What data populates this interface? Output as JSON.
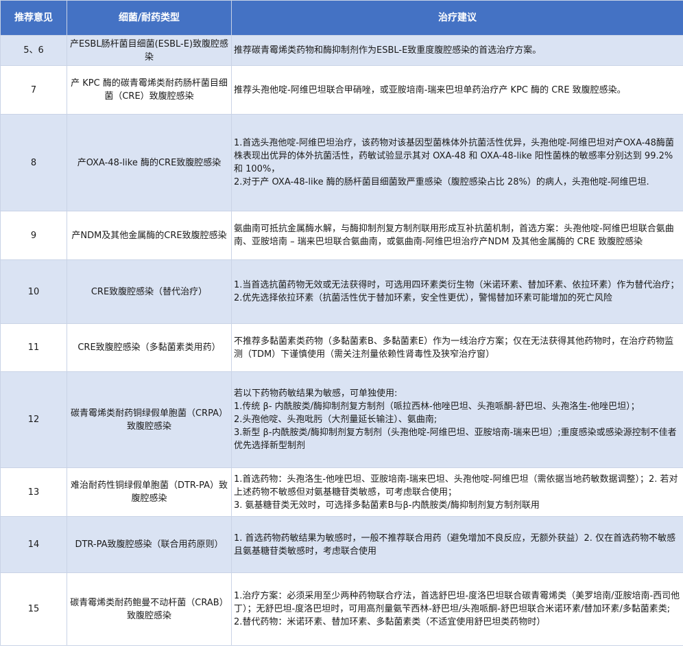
{
  "table": {
    "headers": [
      "推荐意见",
      "细菌/耐药类型",
      "治疗建议"
    ],
    "rows": [
      {
        "rec": "5、6",
        "organism": "产ESBL肠杆菌目细菌(ESBL-E)致腹腔感染",
        "advice": [
          "推荐碳青霉烯类药物和酶抑制剂作为ESBL-E致重度腹腔感染的首选治疗方案。"
        ]
      },
      {
        "rec": "7",
        "organism": "产 KPC 酶的碳青霉烯类耐药肠杆菌目细菌（CRE）致腹腔感染",
        "advice": [
          "推荐头孢他啶-阿维巴坦联合甲硝唑，或亚胺培南-瑞来巴坦单药治疗产 KPC 酶的 CRE 致腹腔感染。"
        ]
      },
      {
        "rec": "8",
        "organism": "产OXA-48-like 酶的CRE致腹腔感染",
        "advice": [
          "1.首选头孢他啶-阿维巴坦治疗，该药物对该基因型菌株体外抗菌活性优异，头孢他啶-阿维巴坦对产OXA-48酶菌株表现出优异的体外抗菌活性，药敏试验显示其对 OXA-48 和 OXA-48-like 阳性菌株的敏感率分别达到 99.2% 和 100%，",
          "2.对于产 OXA-48-like 酶的肠杆菌目细菌致严重感染（腹腔感染占比 28%）的病人，头孢他啶-阿维巴坦."
        ]
      },
      {
        "rec": "9",
        "organism": "产NDM及其他金属酶的CRE致腹腔感染",
        "advice": [
          "氨曲南可抵抗金属酶水解，与酶抑制剂复方制剂联用形成互补抗菌机制，首选方案：头孢他啶-阿维巴坦联合氨曲南、亚胺培南 – 瑞来巴坦联合氨曲南，或氨曲南-阿维巴坦治疗产NDM 及其他金属酶的 CRE 致腹腔感染"
        ]
      },
      {
        "rec": "10",
        "organism": "CRE致腹腔感染（替代治疗）",
        "advice": [
          "1.当首选抗菌药物无效或无法获得时，可选用四环素类衍生物（米诺环素、替加环素、依拉环素）作为替代治疗；",
          "2.优先选择依拉环素（抗菌活性优于替加环素，安全性更优），警惕替加环素可能增加的死亡风险"
        ]
      },
      {
        "rec": "11",
        "organism": "CRE致腹腔感染（多黏菌素类用药）",
        "advice": [
          "不推荐多黏菌素类药物（多黏菌素B、多黏菌素E）作为一线治疗方案；仅在无法获得其他药物时，在治疗药物监测（TDM）下谨慎使用（需关注剂量依赖性肾毒性及狭窄治疗窗）"
        ]
      },
      {
        "rec": "12",
        "organism": "碳青霉烯类耐药铜绿假单胞菌（CRPA）致腹腔感染",
        "advice": [
          "若以下药物药敏结果为敏感，可单独使用:",
          "1.传统 β- 内酰胺类/酶抑制剂复方制剂（哌拉西林-他唑巴坦、头孢哌酮-舒巴坦、头孢洛生-他唑巴坦）；",
          "2.头孢他啶、头孢吡肟（大剂量延长输注）、氨曲南;",
          "3.新型 β-内酰胺类/酶抑制剂复方制剂（头孢他啶-阿维巴坦、亚胺培南-瑞来巴坦）;重度感染或感染源控制不佳者优先选择新型制剂"
        ]
      },
      {
        "rec": "13",
        "organism": "难治耐药性铜绿假单胞菌（DTR-PA）致腹腔感染",
        "advice": [
          "1.首选药物：头孢洛生-他唑巴坦、亚胺培南-瑞来巴坦、头孢他啶-阿维巴坦（需依据当地药敏数据调整）；2. 若对上述药物不敏感但对氨基糖苷类敏感，可考虑联合使用；",
          "3. 氨基糖苷类无效时，可选择多黏菌素B与β-内酰胺类/酶抑制剂复方制剂联用"
        ]
      },
      {
        "rec": "14",
        "organism": "DTR-PA致腹腔感染（联合用药原则）",
        "advice": [
          "1. 首选药物药敏结果为敏感时，一般不推荐联合用药（避免增加不良反应，无额外获益）2. 仅在首选药物不敏感且氨基糖苷类敏感时，考虑联合使用"
        ]
      },
      {
        "rec": "15",
        "organism": "碳青霉烯类耐药鲍曼不动杆菌（CRAB）致腹腔感染",
        "advice": [
          "1.治疗方案：必须采用至少两种药物联合疗法，首选舒巴坦-度洛巴坦联合碳青霉烯类（美罗培南/亚胺培南-西司他丁）；无舒巴坦-度洛巴坦时，可用高剂量氨苄西林-舒巴坦/头孢哌酮-舒巴坦联合米诺环素/替加环素/多黏菌素类;",
          "2.替代药物：米诺环素、替加环素、多黏菌素类（不适宜使用舒巴坦类药物时）"
        ]
      }
    ]
  }
}
